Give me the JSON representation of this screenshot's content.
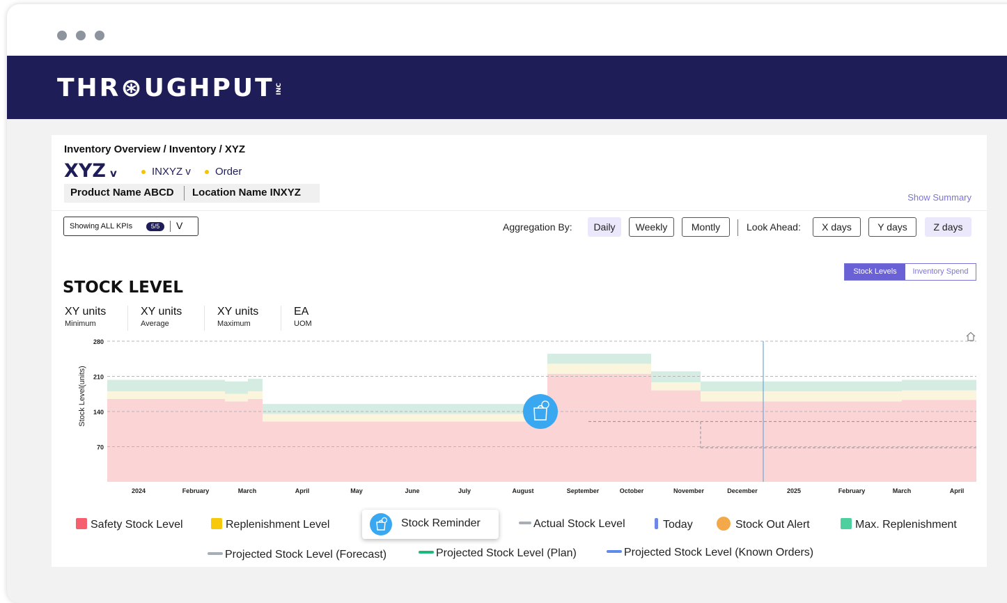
{
  "window": {
    "dots": [
      "red",
      "amber",
      "green"
    ]
  },
  "header": {
    "logo": "THR⊛UGHPUT",
    "logo_suffix": "INC"
  },
  "breadcrumb": "Inventory Overview / Inventory / XYZ",
  "product": {
    "code": "XYZ",
    "code_chevron": "v",
    "location_tag": "INXYZ v",
    "order_tag": "Order",
    "name": "Product Name ABCD",
    "location_name": "Location Name INXYZ"
  },
  "show_summary": "Show Summary",
  "kpi_selector": {
    "label": "Showing ALL KPIs",
    "count": "5/5",
    "chevron": "V"
  },
  "aggregation": {
    "label": "Aggregation By:",
    "options": [
      "Daily",
      "Weekly",
      "Montly"
    ],
    "selected": "Daily"
  },
  "look_ahead": {
    "label": "Look Ahead:",
    "options": [
      "X days",
      "Y days",
      "Z days"
    ],
    "selected": "Z days"
  },
  "view_toggle": {
    "options": [
      "Stock Levels",
      "Inventory Spend"
    ],
    "selected": "Stock Levels"
  },
  "section_title": "STOCK LEVEL",
  "stats": [
    {
      "value": "XY units",
      "caption": "Minimum"
    },
    {
      "value": "XY units",
      "caption": "Average"
    },
    {
      "value": "XY units",
      "caption": "Maximum"
    },
    {
      "value": "EA",
      "caption": "UOM"
    }
  ],
  "icons": {
    "home": "home-icon",
    "reminder": "shopping-bag-bell-icon",
    "alert": "stock-out-alert-icon"
  },
  "colors": {
    "safety": "#f55f6e",
    "safety_fill": "#fbd4d6",
    "replenishment": "#f8c80b",
    "replenishment_fill": "#fbf5dd",
    "max_replenishment": "#4fcf9f",
    "max_fill": "#d5ece3",
    "actual": "#a8aeb6",
    "today": "#6e86e8",
    "today_line": "#6fa8d8",
    "alert": "#f3a94a",
    "plan": "#1eb87a",
    "known": "#5f8ce8",
    "reminder": "#3aa8f0",
    "brand": "#1f1d57",
    "accent": "#6b61d6"
  },
  "chart_data": {
    "type": "area",
    "title": "",
    "ylabel": "Stock Level(units)",
    "xlabel": "",
    "ylim": [
      0,
      280
    ],
    "yticks": [
      70,
      140,
      210,
      280
    ],
    "grid": "horizontal dashed",
    "x_ticks": [
      "2024",
      "February",
      "March",
      "April",
      "May",
      "June",
      "July",
      "August",
      "September",
      "October",
      "November",
      "December",
      "2025",
      "February",
      "March",
      "April"
    ],
    "period_labels": [
      "2024-01",
      "2024-02",
      "2024-03a",
      "2024-03b",
      "2024-04",
      "2024-05",
      "2024-06",
      "2024-07",
      "2024-08",
      "2024-09",
      "2024-10",
      "2024-11",
      "2024-12",
      "2025-01",
      "2025-02",
      "2025-03",
      "2025-04"
    ],
    "series": [
      {
        "name": "Safety Stock Level",
        "values": [
          165,
          165,
          160,
          165,
          120,
          120,
          120,
          120,
          120,
          215,
          215,
          182,
          160,
          160,
          160,
          163,
          163
        ]
      },
      {
        "name": "Replenishment Level",
        "values": [
          180,
          180,
          175,
          180,
          135,
          135,
          135,
          135,
          135,
          235,
          235,
          198,
          180,
          180,
          180,
          182,
          182
        ]
      },
      {
        "name": "Max. Replenishment",
        "values": [
          203,
          203,
          200,
          205,
          155,
          155,
          155,
          155,
          155,
          255,
          255,
          220,
          200,
          200,
          200,
          203,
          203
        ]
      }
    ],
    "projected_forecast": [
      120,
      120,
      120,
      120,
      120,
      120,
      120,
      120,
      120,
      120,
      120,
      120,
      120,
      120,
      120,
      120,
      120
    ],
    "projected_known_orders": [
      68,
      68,
      68,
      68,
      68,
      68
    ],
    "today": "December",
    "stock_reminder_at": "August",
    "legend": [
      {
        "label": "Safety Stock Level",
        "kind": "box",
        "color": "#f55f6e"
      },
      {
        "label": "Replenishment Level",
        "kind": "box",
        "color": "#f8c80b"
      },
      {
        "label": "Stock Reminder",
        "kind": "icon",
        "color": "#3aa8f0"
      },
      {
        "label": "Actual Stock Level",
        "kind": "line",
        "color": "#a8aeb6"
      },
      {
        "label": "Today",
        "kind": "bar",
        "color": "#6e86e8"
      },
      {
        "label": "Stock Out Alert",
        "kind": "icon",
        "color": "#f3a94a"
      },
      {
        "label": "Max. Replenishment",
        "kind": "box",
        "color": "#4fcf9f"
      },
      {
        "label": "Projected Stock Level (Forecast)",
        "kind": "line",
        "color": "#a8aeb6"
      },
      {
        "label": "Projected Stock Level (Plan)",
        "kind": "line",
        "color": "#1eb87a"
      },
      {
        "label": "Projected Stock Level (Known Orders)",
        "kind": "line",
        "color": "#5f8ce8"
      }
    ]
  }
}
